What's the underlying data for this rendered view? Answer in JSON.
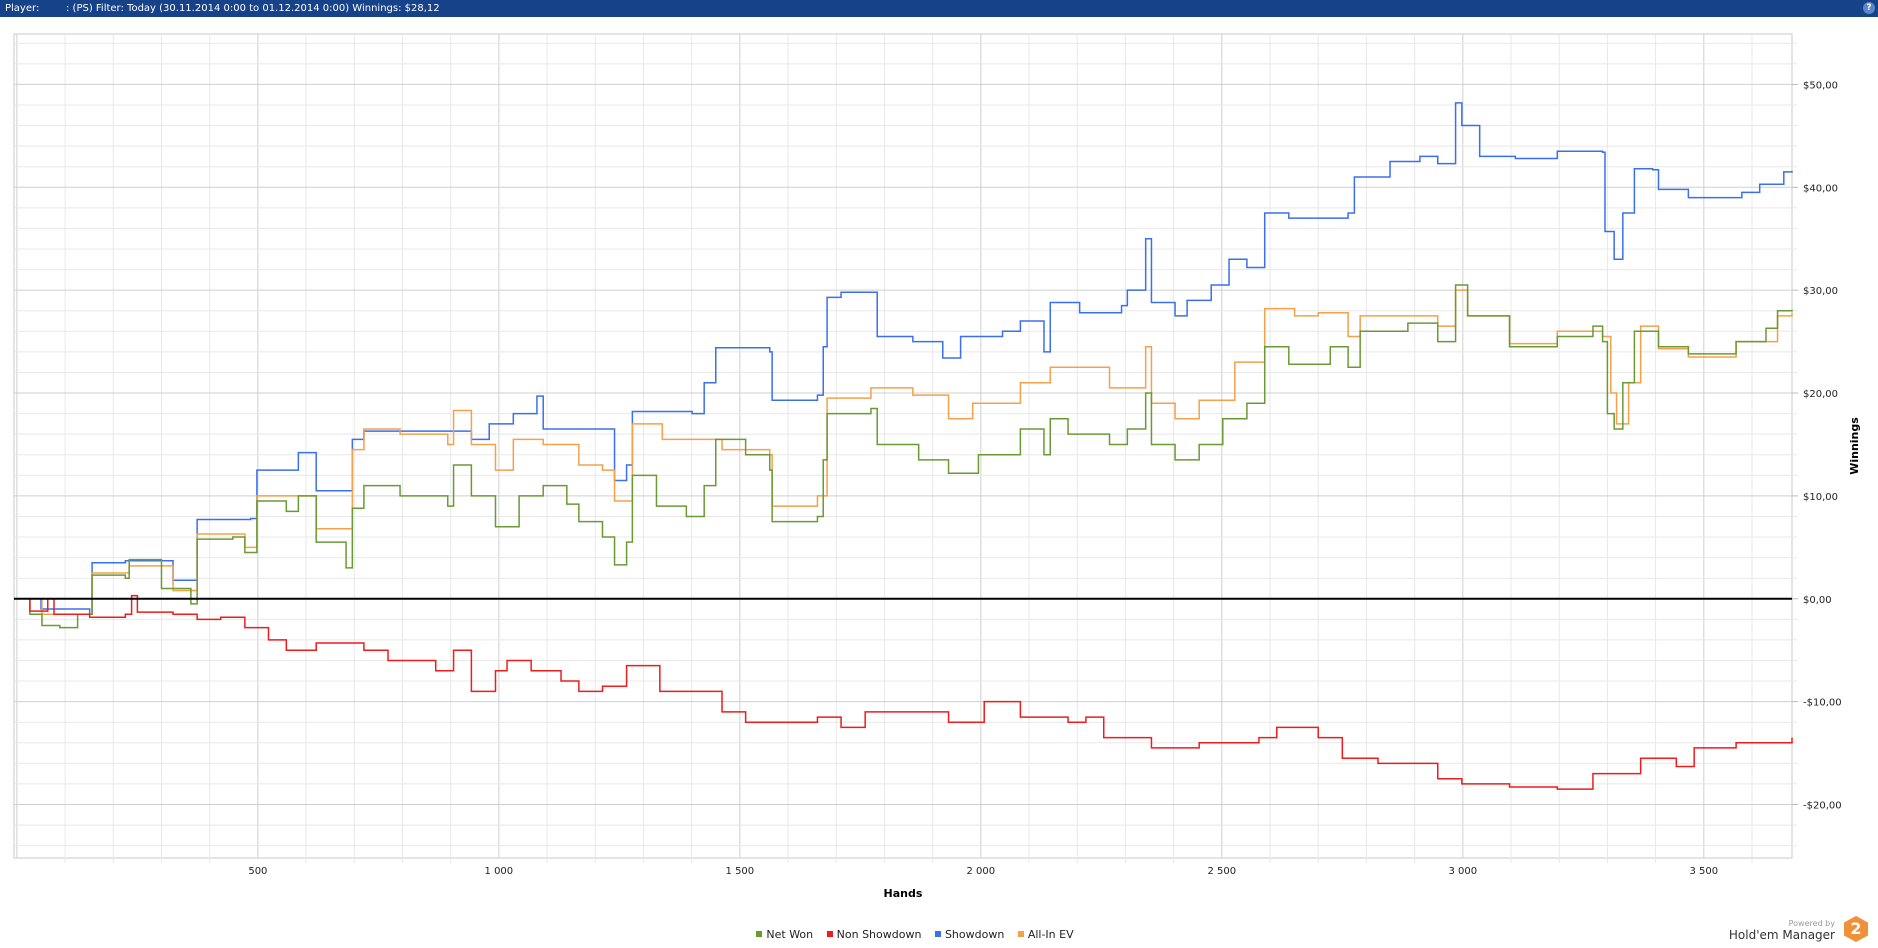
{
  "header": {
    "player_label": "Player:",
    "filter_text": ": (PS) Filter: Today (30.11.2014 0:00 to 01.12.2014 0:00) Winnings: $28,12",
    "help_label": "?"
  },
  "colors": {
    "header_bg": "#16428a",
    "net_won": "#6a9a34",
    "non_showdown": "#ee1c1c",
    "showdown": "#3a6ff0",
    "all_in_ev": "#f5a04a"
  },
  "chart_data": {
    "type": "line",
    "xlabel": "Hands",
    "ylabel": "Winnings",
    "xlim": [
      -6,
      3683
    ],
    "ylim": [
      -25.2,
      54.9
    ],
    "x_ticks": [
      500,
      1000,
      1500,
      2000,
      2500,
      3000,
      3500
    ],
    "x_tick_labels": [
      "500",
      "1 000",
      "1 500",
      "2 000",
      "2 500",
      "3 000",
      "3 500"
    ],
    "y_ticks": [
      -20,
      -10,
      0,
      10,
      20,
      30,
      40,
      50
    ],
    "y_tick_labels": [
      "-$20,00",
      "-$10,00",
      "$0,00",
      "$10,00",
      "$20,00",
      "$30,00",
      "$40,00",
      "$50,00"
    ],
    "grid": true,
    "legend_position": "bottom",
    "series": [
      {
        "name": "Showdown",
        "color": "#3a6ff0",
        "points": [
          [
            0,
            0
          ],
          [
            50,
            -1
          ],
          [
            151,
            -1.5
          ],
          [
            156,
            3.5
          ],
          [
            225,
            3.7
          ],
          [
            324,
            1.8
          ],
          [
            374,
            7.7
          ],
          [
            485,
            7.8
          ],
          [
            498,
            12.5
          ],
          [
            584,
            14.2
          ],
          [
            621,
            10.5
          ],
          [
            696,
            15.5
          ],
          [
            720,
            16.3
          ],
          [
            943,
            15.5
          ],
          [
            980,
            17
          ],
          [
            1030,
            18
          ],
          [
            1079,
            19.7
          ],
          [
            1092,
            16.5
          ],
          [
            1228,
            16.5
          ],
          [
            1240,
            11.5
          ],
          [
            1265,
            13
          ],
          [
            1277,
            18.2
          ],
          [
            1401,
            18
          ],
          [
            1426,
            21
          ],
          [
            1450,
            24.4
          ],
          [
            1562,
            24
          ],
          [
            1567,
            19.3
          ],
          [
            1661,
            19.8
          ],
          [
            1673,
            24.5
          ],
          [
            1681,
            29.3
          ],
          [
            1710,
            29.8
          ],
          [
            1777,
            29.8
          ],
          [
            1785,
            25.5
          ],
          [
            1859,
            25
          ],
          [
            1921,
            23.4
          ],
          [
            1958,
            25.5
          ],
          [
            2045,
            26
          ],
          [
            2082,
            27
          ],
          [
            2131,
            24
          ],
          [
            2144,
            28.8
          ],
          [
            2205,
            27.8
          ],
          [
            2292,
            28.5
          ],
          [
            2304,
            30
          ],
          [
            2342,
            35
          ],
          [
            2354,
            28.8
          ],
          [
            2403,
            27.5
          ],
          [
            2428,
            29
          ],
          [
            2478,
            30.5
          ],
          [
            2515,
            33
          ],
          [
            2552,
            32.2
          ],
          [
            2589,
            37.5
          ],
          [
            2639,
            37
          ],
          [
            2762,
            37.5
          ],
          [
            2775,
            41
          ],
          [
            2849,
            42.5
          ],
          [
            2911,
            43
          ],
          [
            2948,
            42.3
          ],
          [
            2985,
            48.2
          ],
          [
            2998,
            46
          ],
          [
            3035,
            43
          ],
          [
            3109,
            42.8
          ],
          [
            3196,
            43.5
          ],
          [
            3290,
            43.4
          ],
          [
            3295,
            35.7
          ],
          [
            3314,
            33
          ],
          [
            3332,
            37.5
          ],
          [
            3356,
            41.8
          ],
          [
            3394,
            41.7
          ],
          [
            3406,
            39.8
          ],
          [
            3468,
            39
          ],
          [
            3579,
            39.5
          ],
          [
            3616,
            40.3
          ],
          [
            3666,
            41.5
          ],
          [
            3683,
            41.6
          ]
        ]
      },
      {
        "name": "All-In EV",
        "color": "#f5a04a",
        "points": [
          [
            0,
            0
          ],
          [
            52,
            -1.5
          ],
          [
            156,
            2.5
          ],
          [
            233,
            3.2
          ],
          [
            324,
            0.8
          ],
          [
            374,
            6.3
          ],
          [
            473,
            5
          ],
          [
            498,
            10
          ],
          [
            621,
            6.8
          ],
          [
            696,
            14.5
          ],
          [
            720,
            16.5
          ],
          [
            795,
            16
          ],
          [
            894,
            15
          ],
          [
            906,
            18.3
          ],
          [
            943,
            15
          ],
          [
            993,
            12.5
          ],
          [
            1030,
            15.5
          ],
          [
            1092,
            15
          ],
          [
            1166,
            13
          ],
          [
            1215,
            12.5
          ],
          [
            1240,
            9.5
          ],
          [
            1277,
            17
          ],
          [
            1339,
            15.5
          ],
          [
            1463,
            14.5
          ],
          [
            1512,
            14.5
          ],
          [
            1562,
            14
          ],
          [
            1567,
            9
          ],
          [
            1661,
            10
          ],
          [
            1681,
            19.5
          ],
          [
            1772,
            20.5
          ],
          [
            1859,
            19.8
          ],
          [
            1933,
            17.5
          ],
          [
            1983,
            19
          ],
          [
            2082,
            21
          ],
          [
            2144,
            22.5
          ],
          [
            2267,
            20.5
          ],
          [
            2342,
            24.5
          ],
          [
            2354,
            19
          ],
          [
            2403,
            17.5
          ],
          [
            2453,
            19.3
          ],
          [
            2527,
            23
          ],
          [
            2589,
            28.2
          ],
          [
            2651,
            27.5
          ],
          [
            2700,
            27.8
          ],
          [
            2762,
            25.5
          ],
          [
            2787,
            27.5
          ],
          [
            2886,
            27.5
          ],
          [
            2948,
            26.5
          ],
          [
            2985,
            30
          ],
          [
            3010,
            27.5
          ],
          [
            3097,
            24.8
          ],
          [
            3196,
            26
          ],
          [
            3290,
            25.5
          ],
          [
            3307,
            20
          ],
          [
            3319,
            17
          ],
          [
            3344,
            21
          ],
          [
            3369,
            26.5
          ],
          [
            3406,
            24.3
          ],
          [
            3468,
            23.5
          ],
          [
            3567,
            25
          ],
          [
            3653,
            27.5
          ],
          [
            3683,
            27.8
          ]
        ]
      },
      {
        "name": "Net Won",
        "color": "#6a9a34",
        "points": [
          [
            0,
            0
          ],
          [
            27,
            -1.5
          ],
          [
            52,
            -2.6
          ],
          [
            89,
            -2.8
          ],
          [
            126,
            -1.5
          ],
          [
            156,
            2.3
          ],
          [
            225,
            2
          ],
          [
            233,
            3.8
          ],
          [
            300,
            1
          ],
          [
            361,
            -0.5
          ],
          [
            374,
            5.8
          ],
          [
            448,
            6
          ],
          [
            473,
            4.5
          ],
          [
            498,
            9.5
          ],
          [
            559,
            8.5
          ],
          [
            584,
            10
          ],
          [
            621,
            5.5
          ],
          [
            683,
            3
          ],
          [
            696,
            8.8
          ],
          [
            720,
            11
          ],
          [
            795,
            10
          ],
          [
            894,
            9
          ],
          [
            906,
            13
          ],
          [
            943,
            10
          ],
          [
            993,
            7
          ],
          [
            1042,
            10
          ],
          [
            1092,
            11
          ],
          [
            1141,
            9.2
          ],
          [
            1166,
            7.5
          ],
          [
            1215,
            6
          ],
          [
            1240,
            3.3
          ],
          [
            1265,
            5.5
          ],
          [
            1277,
            12
          ],
          [
            1327,
            9
          ],
          [
            1389,
            8
          ],
          [
            1426,
            11
          ],
          [
            1450,
            15.5
          ],
          [
            1512,
            14
          ],
          [
            1562,
            12.5
          ],
          [
            1567,
            7.5
          ],
          [
            1661,
            8
          ],
          [
            1673,
            13.5
          ],
          [
            1681,
            18
          ],
          [
            1772,
            18.5
          ],
          [
            1785,
            15
          ],
          [
            1871,
            13.5
          ],
          [
            1933,
            12.2
          ],
          [
            1995,
            14
          ],
          [
            2082,
            16.5
          ],
          [
            2131,
            14
          ],
          [
            2144,
            17.5
          ],
          [
            2181,
            16
          ],
          [
            2267,
            15
          ],
          [
            2304,
            16.5
          ],
          [
            2342,
            20
          ],
          [
            2354,
            15
          ],
          [
            2403,
            13.5
          ],
          [
            2453,
            15
          ],
          [
            2502,
            17.5
          ],
          [
            2552,
            19
          ],
          [
            2589,
            24.5
          ],
          [
            2639,
            22.8
          ],
          [
            2725,
            24.5
          ],
          [
            2762,
            22.5
          ],
          [
            2787,
            26
          ],
          [
            2886,
            26.8
          ],
          [
            2948,
            25
          ],
          [
            2985,
            30.5
          ],
          [
            3010,
            27.5
          ],
          [
            3097,
            24.5
          ],
          [
            3196,
            25.5
          ],
          [
            3270,
            26.5
          ],
          [
            3290,
            25
          ],
          [
            3300,
            18
          ],
          [
            3314,
            16.5
          ],
          [
            3332,
            21
          ],
          [
            3356,
            26
          ],
          [
            3406,
            24.5
          ],
          [
            3468,
            23.8
          ],
          [
            3567,
            25
          ],
          [
            3629,
            26.3
          ],
          [
            3653,
            28
          ],
          [
            3683,
            28.1
          ]
        ]
      },
      {
        "name": "Non Showdown",
        "color": "#ee1c1c",
        "points": [
          [
            0,
            0
          ],
          [
            27,
            -1.2
          ],
          [
            64,
            0
          ],
          [
            77,
            -1.5
          ],
          [
            151,
            -1.8
          ],
          [
            225,
            -1.5
          ],
          [
            238,
            0.3
          ],
          [
            250,
            -1.3
          ],
          [
            324,
            -1.5
          ],
          [
            374,
            -2
          ],
          [
            423,
            -1.8
          ],
          [
            473,
            -2.8
          ],
          [
            522,
            -4
          ],
          [
            559,
            -5
          ],
          [
            621,
            -4.3
          ],
          [
            720,
            -5
          ],
          [
            770,
            -6
          ],
          [
            869,
            -7
          ],
          [
            906,
            -5
          ],
          [
            943,
            -9
          ],
          [
            993,
            -7
          ],
          [
            1017,
            -6
          ],
          [
            1067,
            -7
          ],
          [
            1129,
            -8
          ],
          [
            1166,
            -9
          ],
          [
            1215,
            -8.5
          ],
          [
            1265,
            -6.5
          ],
          [
            1334,
            -9
          ],
          [
            1463,
            -11
          ],
          [
            1512,
            -12
          ],
          [
            1611,
            -12
          ],
          [
            1661,
            -11.5
          ],
          [
            1710,
            -12.5
          ],
          [
            1760,
            -11
          ],
          [
            1859,
            -11
          ],
          [
            1933,
            -12
          ],
          [
            2007,
            -10
          ],
          [
            2082,
            -11.5
          ],
          [
            2181,
            -12
          ],
          [
            2218,
            -11.5
          ],
          [
            2255,
            -13.5
          ],
          [
            2354,
            -14.5
          ],
          [
            2453,
            -14
          ],
          [
            2577,
            -13.5
          ],
          [
            2614,
            -12.5
          ],
          [
            2700,
            -13.5
          ],
          [
            2750,
            -15.5
          ],
          [
            2824,
            -16
          ],
          [
            2948,
            -17.5
          ],
          [
            2998,
            -18
          ],
          [
            3097,
            -18.3
          ],
          [
            3196,
            -18.5
          ],
          [
            3270,
            -17
          ],
          [
            3369,
            -15.5
          ],
          [
            3443,
            -16.3
          ],
          [
            3480,
            -14.5
          ],
          [
            3567,
            -14
          ],
          [
            3683,
            -13.5
          ]
        ]
      }
    ]
  },
  "legend": [
    {
      "label": "Net Won",
      "color": "#6a9a34"
    },
    {
      "label": "Non Showdown",
      "color": "#ee1c1c"
    },
    {
      "label": "Showdown",
      "color": "#3a6ff0"
    },
    {
      "label": "All-In EV",
      "color": "#f5a04a"
    }
  ],
  "branding": {
    "powered_by": "Powered by",
    "product": "Hold'em Manager",
    "version_badge": "2"
  }
}
